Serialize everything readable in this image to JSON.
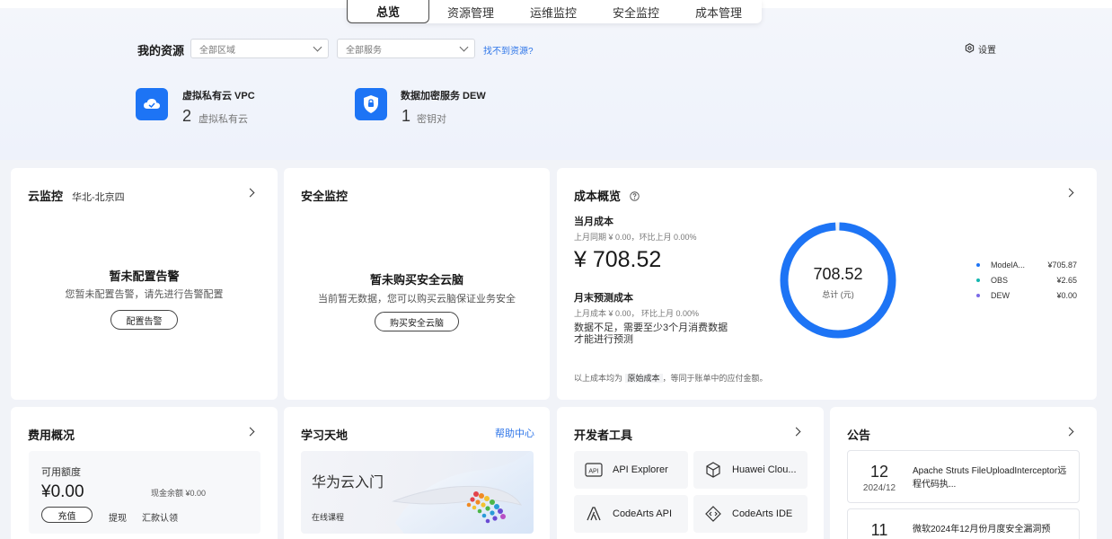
{
  "tabs": [
    "总览",
    "资源管理",
    "运维监控",
    "安全监控",
    "成本管理"
  ],
  "resources": {
    "title": "我的资源",
    "region_select": "全部区域",
    "service_select": "全部服务",
    "missing_link": "找不到资源?",
    "settings_label": "设置",
    "services": [
      {
        "name": "虚拟私有云 VPC",
        "count": "2",
        "unit": "虚拟私有云",
        "icon": "cloud-icon"
      },
      {
        "name": "数据加密服务 DEW",
        "count": "1",
        "unit": "密钥对",
        "icon": "shield-icon"
      }
    ]
  },
  "monitor": {
    "title": "云监控",
    "region": "华北-北京四",
    "empty_title": "暂未配置告警",
    "empty_desc": "您暂未配置告警，请先进行告警配置",
    "button": "配置告警"
  },
  "security": {
    "title": "安全监控",
    "empty_title": "暂未购买安全云脑",
    "empty_desc": "当前暂无数据，您可以购买云脑保证业务安全",
    "button": "购买安全云脑"
  },
  "cost": {
    "title": "成本概览",
    "current_label": "当月成本",
    "current_compare": "上月同期 ¥ 0.00，环比上月  0.00%",
    "current_value": "¥ 708.52",
    "forecast_label": "月末预测成本",
    "forecast_compare": "上月成本 ¥ 0.00，  环比上月  0.00%",
    "forecast_note_1": "数据不足，需要至少3个月消费数据",
    "forecast_note_2": "才能进行预测",
    "foot_prefix": "以上成本均为",
    "foot_highlight": "原始成本",
    "foot_suffix": "，等同于账单中的应付金额。",
    "donut_total": "708.52",
    "donut_caption": "总计 (元)",
    "legend": [
      {
        "name": "ModelA...",
        "value": "¥705.87",
        "color": "#1d74f5"
      },
      {
        "name": "OBS",
        "value": "¥2.65",
        "color": "#15b6b0"
      },
      {
        "name": "DEW",
        "value": "¥0.00",
        "color": "#7b6ae6"
      }
    ],
    "accent": "#1d74f5"
  },
  "fees": {
    "title": "费用概况",
    "available_label": "可用额度",
    "available_value": "¥0.00",
    "cash_balance": "现金余额 ¥0.00",
    "recharge_button": "充值",
    "withdraw_link": "提现",
    "remit_link": "汇款认领"
  },
  "learn": {
    "title": "学习天地",
    "help_link": "帮助中心",
    "banner_title": "华为云入门",
    "banner_sub": "在线课程"
  },
  "devtools": {
    "title": "开发者工具",
    "tools": [
      {
        "label": "API Explorer",
        "icon": "api-icon"
      },
      {
        "label": "Huawei Clou...",
        "icon": "cube-icon"
      },
      {
        "label": "CodeArts API",
        "icon": "codearts-api-icon"
      },
      {
        "label": "CodeArts IDE",
        "icon": "code-brackets-icon"
      }
    ]
  },
  "notices": {
    "title": "公告",
    "items": [
      {
        "day": "12",
        "month": "2024/12",
        "text": "Apache Struts FileUploadInterceptor远程代码执..."
      },
      {
        "day": "11",
        "month": "",
        "text": "微软2024年12月份月度安全漏洞预"
      }
    ]
  }
}
